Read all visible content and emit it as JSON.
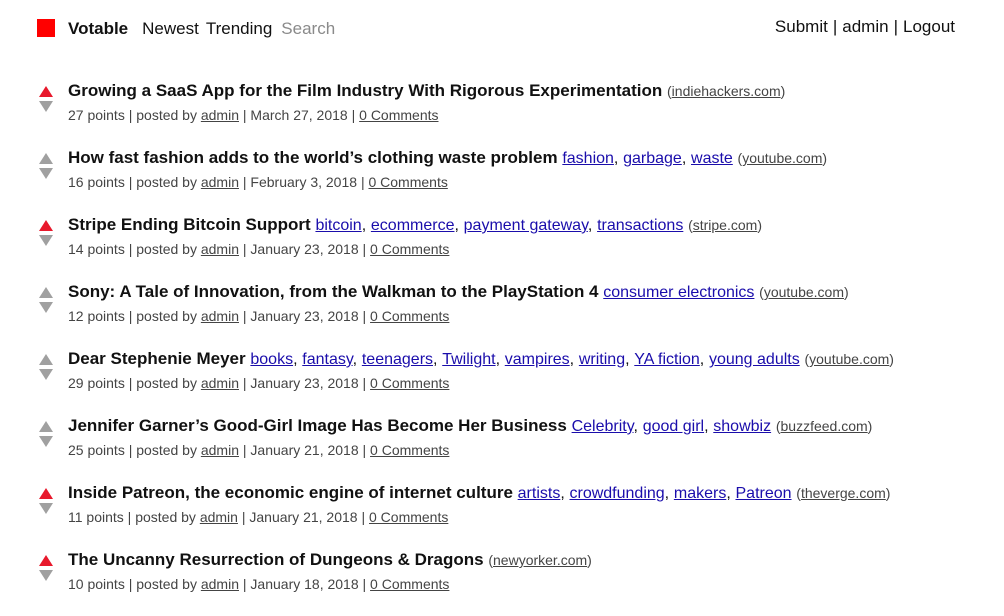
{
  "nav": {
    "brand": "Votable",
    "links": [
      "Newest",
      "Trending"
    ],
    "search_placeholder": "Search",
    "submit": "Submit",
    "user": "admin",
    "logout": "Logout",
    "brand_color": "#ff0000"
  },
  "stories": [
    {
      "title": "Growing a SaaS App for the Film Industry With Rigorous Experimentation",
      "tags": [],
      "domain": "indiehackers.com",
      "points": "27 points",
      "author": "admin",
      "date": "March 27, 2018",
      "comments": "0 Comments",
      "upvoted": true
    },
    {
      "title": "How fast fashion adds to the world’s clothing waste problem",
      "tags": [
        "fashion",
        "garbage",
        "waste"
      ],
      "domain": "youtube.com",
      "points": "16 points",
      "author": "admin",
      "date": "February 3, 2018",
      "comments": "0 Comments",
      "upvoted": false
    },
    {
      "title": "Stripe Ending Bitcoin Support",
      "tags": [
        "bitcoin",
        "ecommerce",
        "payment gateway",
        "transactions"
      ],
      "domain": "stripe.com",
      "points": "14 points",
      "author": "admin",
      "date": "January 23, 2018",
      "comments": "0 Comments",
      "upvoted": true
    },
    {
      "title": "Sony: A Tale of Innovation, from the Walkman to the PlayStation 4",
      "tags": [
        "consumer electronics"
      ],
      "domain": "youtube.com",
      "points": "12 points",
      "author": "admin",
      "date": "January 23, 2018",
      "comments": "0 Comments",
      "upvoted": false
    },
    {
      "title": "Dear Stephenie Meyer",
      "tags": [
        "books",
        "fantasy",
        "teenagers",
        "Twilight",
        "vampires",
        "writing",
        "YA fiction",
        "young adults"
      ],
      "domain": "youtube.com",
      "points": "29 points",
      "author": "admin",
      "date": "January 23, 2018",
      "comments": "0 Comments",
      "upvoted": false
    },
    {
      "title": "Jennifer Garner’s Good-Girl Image Has Become Her Business",
      "tags": [
        "Celebrity",
        "good girl",
        "showbiz"
      ],
      "domain": "buzzfeed.com",
      "points": "25 points",
      "author": "admin",
      "date": "January 21, 2018",
      "comments": "0 Comments",
      "upvoted": false
    },
    {
      "title": "Inside Patreon, the economic engine of internet culture",
      "tags": [
        "artists",
        "crowdfunding",
        "makers",
        "Patreon"
      ],
      "domain": "theverge.com",
      "points": "11 points",
      "author": "admin",
      "date": "January 21, 2018",
      "comments": "0 Comments",
      "upvoted": true
    },
    {
      "title": "The Uncanny Resurrection of Dungeons & Dragons",
      "tags": [],
      "domain": "newyorker.com",
      "points": "10 points",
      "author": "admin",
      "date": "January 18, 2018",
      "comments": "0 Comments",
      "upvoted": true
    }
  ],
  "labels": {
    "posted_by": "posted by",
    "separator": "|"
  },
  "colors": {
    "upvote_active": "#e8192c",
    "vote_inactive": "#a0a0a0",
    "tag_link": "#1a0dab"
  }
}
